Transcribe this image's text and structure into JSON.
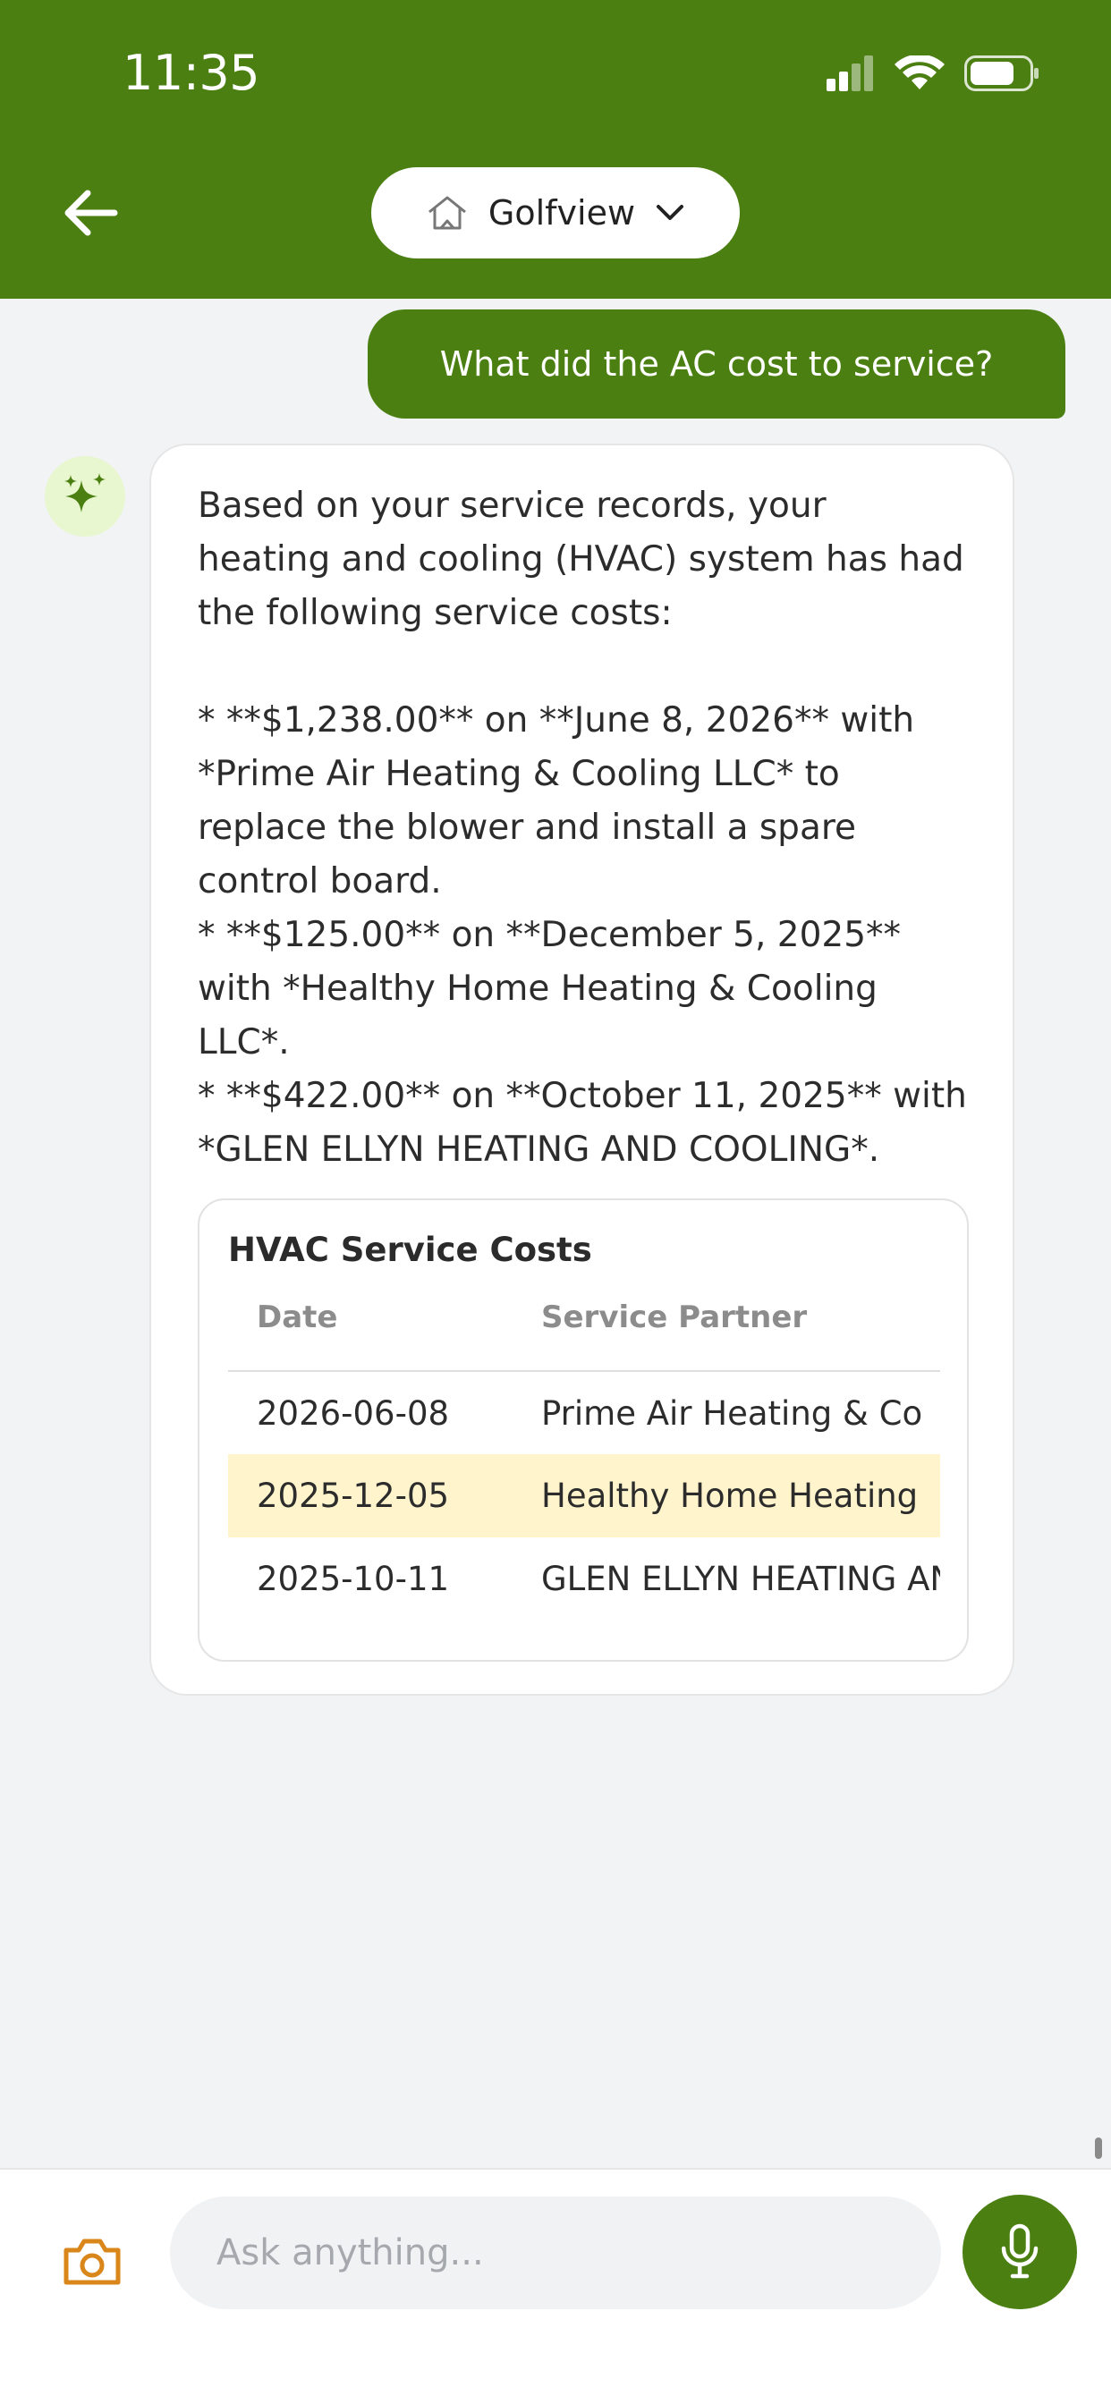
{
  "status_bar": {
    "time": "11:35"
  },
  "header": {
    "property_name": "Golfview"
  },
  "conversation": {
    "user_message": "What did the AC cost to service?",
    "assistant_message": "Based on your service records, your heating and cooling (HVAC) system has had the following service costs:\n\n* **$1,238.00** on **June 8, 2026** with *Prime Air Heating & Cooling LLC* to replace the blower and install a spare control board.\n* **$125.00** on **December 5, 2025** with *Healthy Home Heating & Cooling LLC*.\n* **$422.00** on **October 11, 2025** with *GLEN ELLYN HEATING AND COOLING*.",
    "table": {
      "title": "HVAC Service Costs",
      "columns": [
        "Date",
        "Service Partner"
      ],
      "rows": [
        [
          "2026-06-08",
          "Prime Air Heating & Co"
        ],
        [
          "2025-12-05",
          "Healthy Home Heating"
        ],
        [
          "2025-10-11",
          "GLEN ELLYN HEATING AN"
        ]
      ]
    }
  },
  "composer": {
    "placeholder": "Ask anything..."
  },
  "colors": {
    "brand_green": "#4b7f12",
    "highlight_row": "#fff4cc",
    "camera_orange": "#d9861a",
    "avatar_bg": "#e8f7cf"
  },
  "icons": {
    "back": "arrow-left-icon",
    "home": "home-icon",
    "dropdown": "chevron-down-icon",
    "assistant": "sparkle-icon",
    "camera": "camera-icon",
    "mic": "microphone-icon"
  }
}
